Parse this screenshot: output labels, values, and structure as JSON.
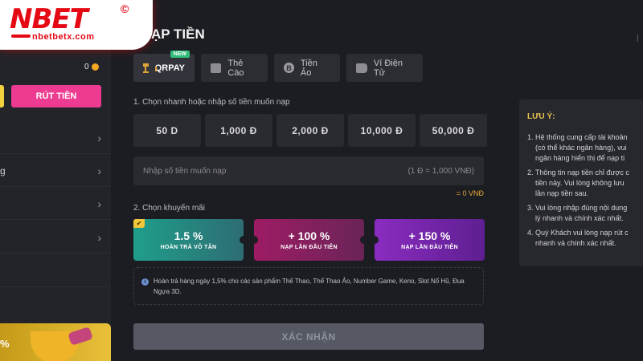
{
  "logo": {
    "word": "NBET",
    "copyright": "©",
    "domain": "nbetbetx.com"
  },
  "header": {
    "title": "ẠP TIỀN",
    "right_mark": "|"
  },
  "sidebar": {
    "balance": "0",
    "withdraw_button": "RÚT TIỀN",
    "menu": [
      {
        "label": "",
        "chevron": "›"
      },
      {
        "label": "g",
        "chevron": "›"
      },
      {
        "label": "",
        "chevron": "›"
      },
      {
        "label": "",
        "chevron": "›"
      },
      {
        "label": "",
        "chevron": ""
      }
    ],
    "promo_percent": "%"
  },
  "tabs": [
    {
      "label": "QRPAY",
      "icon": "bank-icon",
      "badge": "NEW",
      "active": true
    },
    {
      "label": "Thẻ Cào",
      "icon": "card-icon"
    },
    {
      "label": "Tiền Ảo",
      "icon": "bitcoin-icon",
      "glyph": "B"
    },
    {
      "label": "Ví Điện Tử",
      "icon": "wallet-icon"
    }
  ],
  "step1": {
    "label": "1. Chọn nhanh hoặc nhập số tiền muốn nạp",
    "amounts": [
      "50 D",
      "1,000 Đ",
      "2,000 Đ",
      "10,000 Đ",
      "50,000 Đ"
    ],
    "input_placeholder": "Nhập số tiền muốn nạp",
    "input_hint": "(1 Đ = 1,000 VNĐ)",
    "converted": "= 0 VNĐ"
  },
  "step2": {
    "label": "2. Chọn khuyến mãi",
    "promos": [
      {
        "value": "1.5 %",
        "caption": "HOÀN TRẢ VÔ TẬN",
        "selected": true,
        "check": "✔"
      },
      {
        "value": "+ 100 %",
        "caption": "NẠP LẦN ĐẦU TIÊN"
      },
      {
        "value": "+ 150 %",
        "caption": "NẠP LẦN ĐẦU TIÊN"
      }
    ],
    "info_icon": "i",
    "info_text": "Hoàn trả hàng ngày 1,5% cho các sản phẩm Thể Thao, Thể Thao Ảo, Number Game, Keno, Slot Nổ Hũ, Đua Ngựa 3D."
  },
  "confirm_button": "XÁC NHẬN",
  "notes": {
    "title": "LƯU Ý:",
    "items": [
      "1. Hệ thống cung cấp tài khoản\n    (có thể khác ngân hàng), vui\n    ngân hàng hiển thị để nạp ti",
      "2. Thông tin nạp tiền chỉ được c\n    tiền này. Vui lòng không lưu\n    lần nạp tiền sau.",
      "3. Vui lòng nhập đúng nội dung\n    lý nhanh và chính xác nhất.",
      "4. Quý Khách vui lòng nạp rút c\n    nhanh và chính xác nhất."
    ]
  }
}
